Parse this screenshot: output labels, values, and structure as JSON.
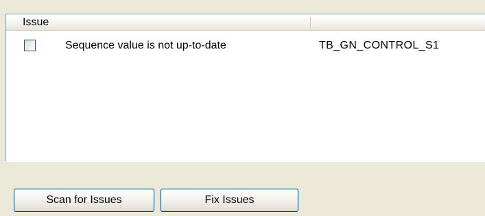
{
  "issues_list": {
    "columns": [
      {
        "label": "Issue"
      },
      {
        "label": ""
      }
    ],
    "rows": [
      {
        "checked": false,
        "issue": "Sequence value is not up-to-date",
        "object": "TB_GN_CONTROL_S1"
      }
    ]
  },
  "buttons": {
    "scan_label": "Scan for Issues",
    "fix_label": "Fix Issues"
  }
}
